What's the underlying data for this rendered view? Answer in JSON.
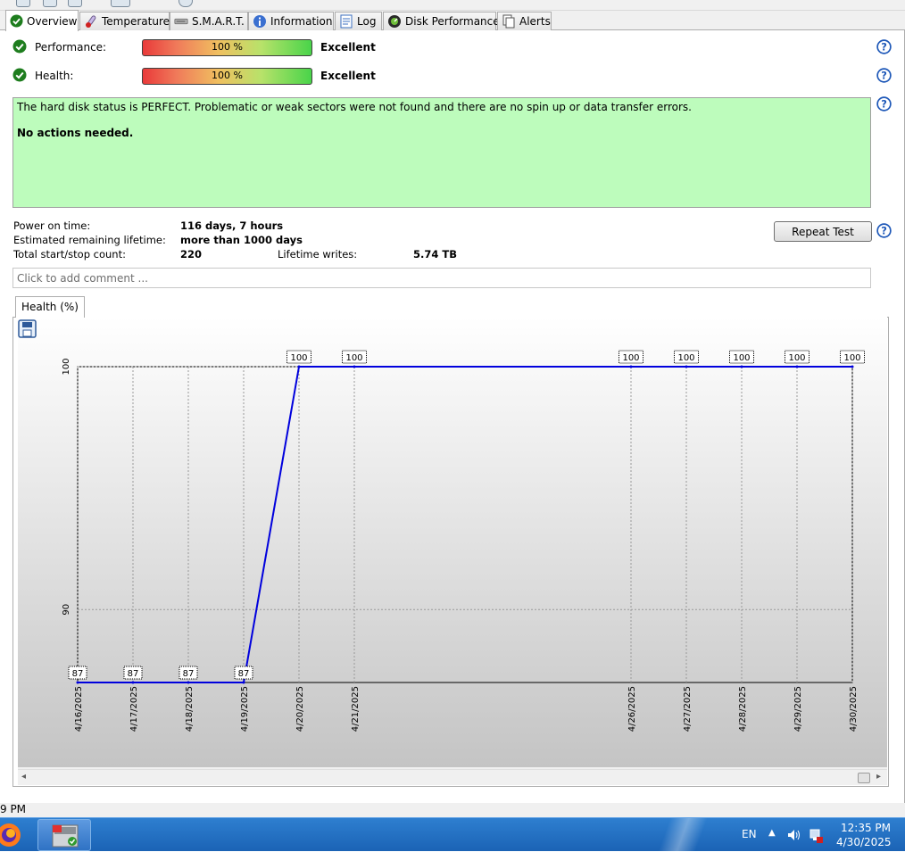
{
  "tabs": [
    {
      "label": "Overview",
      "icon": "check-circle-icon",
      "active": true
    },
    {
      "label": "Temperature",
      "icon": "thermometer-icon",
      "active": false
    },
    {
      "label": "S.M.A.R.T.",
      "icon": "smart-drive-icon",
      "active": false
    },
    {
      "label": "Information",
      "icon": "info-icon",
      "active": false
    },
    {
      "label": "Log",
      "icon": "log-icon",
      "active": false
    },
    {
      "label": "Disk Performance",
      "icon": "performance-gauge-icon",
      "active": false
    },
    {
      "label": "Alerts",
      "icon": "alerts-icon",
      "active": false
    }
  ],
  "metrics": {
    "performance": {
      "label": "Performance:",
      "value": "100 %",
      "percent": 100,
      "rating": "Excellent"
    },
    "health": {
      "label": "Health:",
      "value": "100 %",
      "percent": 100,
      "rating": "Excellent"
    }
  },
  "status": {
    "message": "The hard disk status is PERFECT. Problematic or weak sectors were not found and there are no spin up or data transfer errors.",
    "action": "No actions needed.",
    "background": "#bdfcbc"
  },
  "info": {
    "power_on_label": "Power on time:",
    "power_on_value": "116 days, 7 hours",
    "lifetime_label": "Estimated remaining lifetime:",
    "lifetime_value": "more than 1000 days",
    "startstop_label": "Total start/stop count:",
    "startstop_value": "220",
    "writes_label": "Lifetime writes:",
    "writes_value": "5.74 TB"
  },
  "repeat_test_label": "Repeat Test",
  "comment_placeholder": "Click to add comment ...",
  "chart_tab_label": "Health (%)",
  "chart_data": {
    "type": "line",
    "x": [
      "4/16/2025",
      "4/17/2025",
      "4/18/2025",
      "4/19/2025",
      "4/20/2025",
      "4/21/2025",
      "4/26/2025",
      "4/27/2025",
      "4/28/2025",
      "4/29/2025",
      "4/30/2025"
    ],
    "series": [
      {
        "values": [
          87,
          87,
          87,
          87,
          100,
          100,
          100,
          100,
          100,
          100,
          100
        ],
        "color": "#0000dd"
      }
    ],
    "yticks": [
      90,
      100
    ],
    "ylim": [
      87,
      100
    ],
    "grid": true
  },
  "status_line_text": "9 PM",
  "tray": {
    "lang": "EN",
    "time": "12:35 PM",
    "date": "4/30/2025"
  }
}
